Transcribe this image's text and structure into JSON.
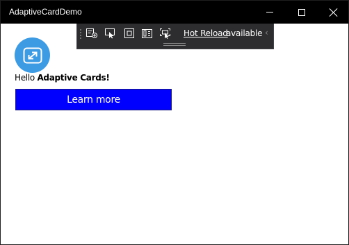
{
  "window": {
    "title": "AdaptiveCardDemo"
  },
  "titlebar_controls": [
    "minimize-icon",
    "maximize-icon",
    "close-icon"
  ],
  "toolbar": {
    "icons": [
      "live-visual-tree-icon",
      "select-element-icon",
      "display-layout-adorners-icon",
      "track-focus-icon",
      "preview-selection-icon"
    ],
    "hot_reload_link": "Hot Reload",
    "hot_reload_status": "available",
    "collapse_icon": "chevron-left-icon"
  },
  "card": {
    "icon": "expand-arrows-icon",
    "icon_color": "#3d9be3",
    "greeting_prefix": "Hello",
    "greeting_bold": "Adaptive Cards!",
    "action_label": "Learn more",
    "action_color": "#0000ff"
  }
}
